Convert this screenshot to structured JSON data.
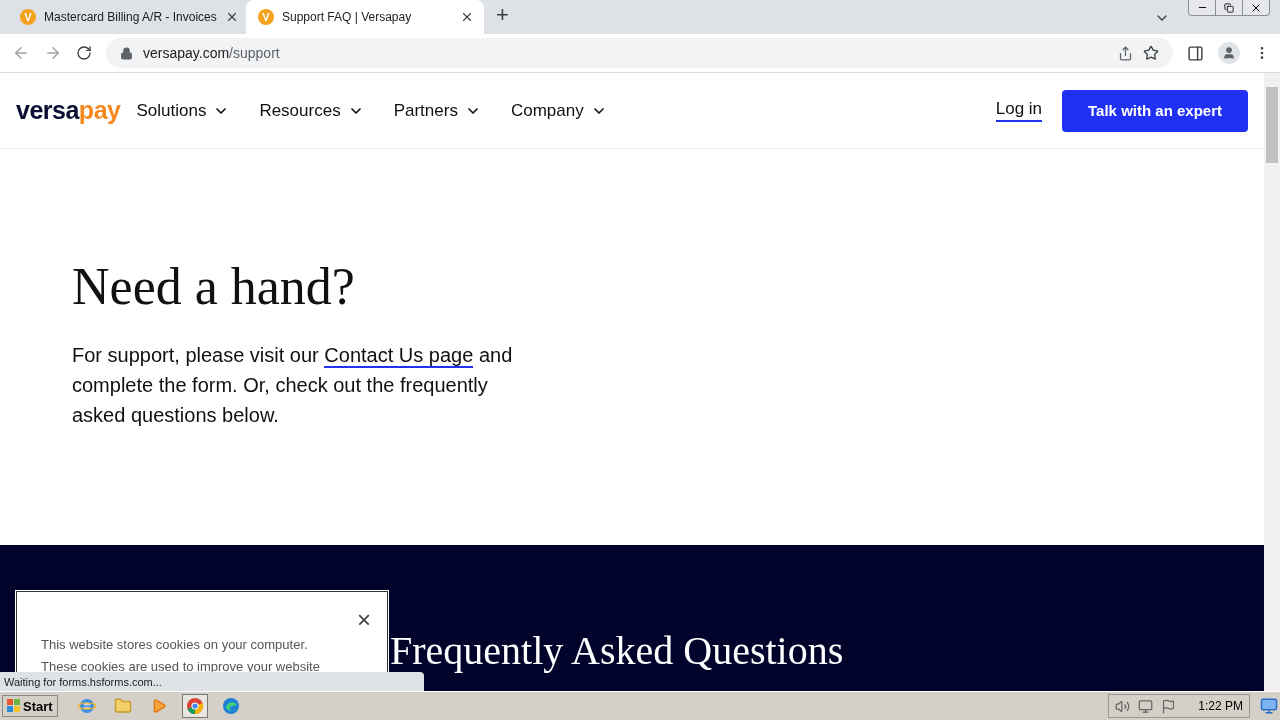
{
  "browser": {
    "tabs": [
      {
        "title": "Mastercard Billing A/R - Invoices",
        "favicon": "V",
        "selected": false
      },
      {
        "title": "Support FAQ | Versapay",
        "favicon": "V",
        "selected": true
      }
    ],
    "new_tab": "+",
    "address": {
      "host": "versapay.com",
      "path": "/support"
    }
  },
  "nav": {
    "logo": [
      "versa",
      "pay"
    ],
    "menu": [
      {
        "label": "Solutions"
      },
      {
        "label": "Resources"
      },
      {
        "label": "Partners"
      },
      {
        "label": "Company"
      }
    ],
    "login": "Log in",
    "cta": "Talk with an expert"
  },
  "hero": {
    "title": "Need a hand?",
    "intro": {
      "before": "For support, please visit our ",
      "link": "Contact Us page",
      "after": " and complete the form. Or, check out the frequently asked questions below."
    }
  },
  "faq": {
    "title": "Frequently Asked Questions"
  },
  "cookie_banner": {
    "close": "×",
    "lines": [
      "This website stores cookies on your computer.",
      "These cookies are used to improve your website"
    ]
  },
  "status": "Waiting for forms.hsforms.com...",
  "taskbar": {
    "start": "Start",
    "apps": [
      {
        "kind": "ie",
        "active": false
      },
      {
        "kind": "folder",
        "active": false
      },
      {
        "kind": "media",
        "active": false
      },
      {
        "kind": "chrome",
        "active": true
      },
      {
        "kind": "edge",
        "active": false
      }
    ],
    "time": "1:22 PM"
  }
}
